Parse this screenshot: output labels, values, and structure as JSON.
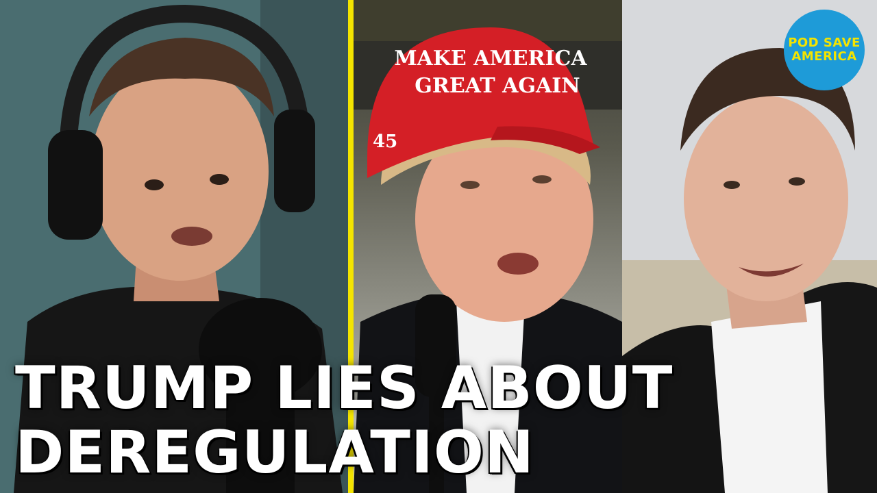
{
  "headline": {
    "line1": "TRUMP LIES ABOUT",
    "line2": "DEREGULATION"
  },
  "logo": {
    "line1": "POD SAVE",
    "line2": "AMERICA"
  },
  "hat": {
    "line1": "MAKE AMERICA",
    "line2": "GREAT AGAIN",
    "side_number": "45"
  },
  "colors": {
    "divider": "#f4e400",
    "logo_bg": "#1e9bd8",
    "logo_text": "#f4e400",
    "hat_red": "#d41f26",
    "headline": "#ffffff"
  }
}
